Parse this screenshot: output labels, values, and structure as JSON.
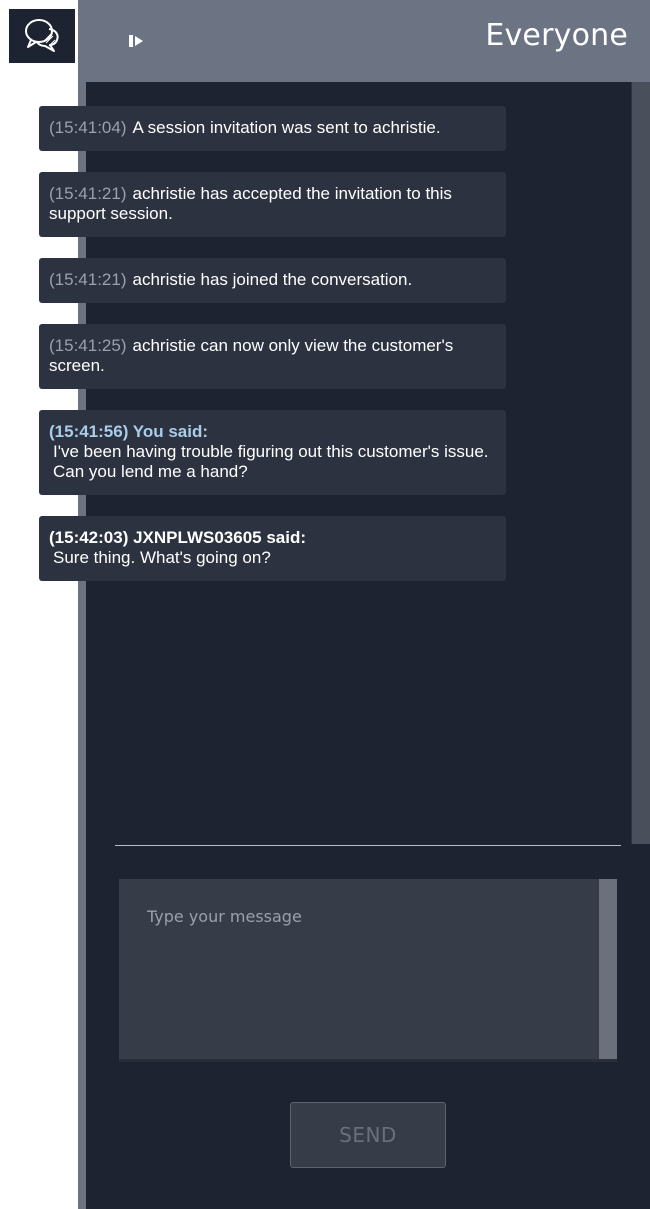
{
  "header": {
    "title": "Everyone"
  },
  "messages": [
    {
      "kind": "system",
      "time": "(15:41:04)",
      "text": "A session invitation was sent to achristie."
    },
    {
      "kind": "system",
      "time": "(15:41:21)",
      "text": "achristie has accepted the invitation to this support session."
    },
    {
      "kind": "system",
      "time": "(15:41:21)",
      "text": "achristie has joined the conversation."
    },
    {
      "kind": "system",
      "time": "(15:41:25)",
      "text": "achristie can now only view the customer's screen."
    },
    {
      "kind": "chat",
      "sender": "me",
      "header": "(15:41:56) You said:",
      "text": "I've been having trouble figuring out this customer's issue. Can you lend me a hand?"
    },
    {
      "kind": "chat",
      "sender": "other",
      "header": "(15:42:03) JXNPLWS03605 said:",
      "text": "Sure thing. What's going on?"
    }
  ],
  "composer": {
    "placeholder": "Type your message",
    "send_label": "SEND"
  },
  "icons": {
    "chat": "chat-bubbles-icon",
    "exit": "exit-session-icon"
  },
  "colors": {
    "panel_bg": "#1d2330",
    "header_bg": "#6c7383",
    "bubble_bg": "#2d3240",
    "self_name": "#a9cde8"
  }
}
